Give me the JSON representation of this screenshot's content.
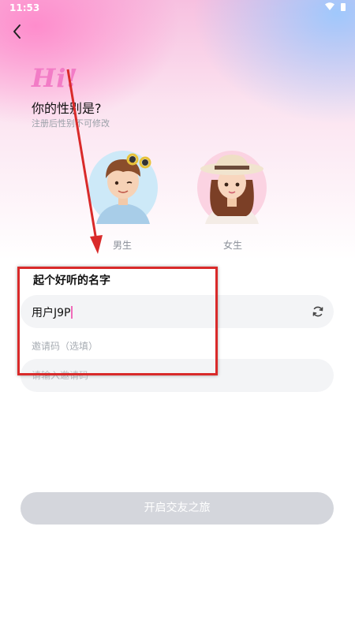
{
  "status_bar": {
    "time": "11:53"
  },
  "header": {
    "back_icon": "chevron-left-icon"
  },
  "hero": {
    "greeting": "Hi!",
    "question": "你的性别是?",
    "note": "注册后性别不可修改"
  },
  "gender": {
    "male_label": "男生",
    "female_label": "女生"
  },
  "name_section": {
    "title": "起个好听的名字",
    "value": "用户J9P",
    "refresh_icon": "refresh-icon"
  },
  "invite_section": {
    "label": "邀请码（选填）",
    "placeholder": "请输入邀请码"
  },
  "submit": {
    "label": "开启交友之旅"
  },
  "colors": {
    "accent_pink": "#f27cc6",
    "annotation_red": "#d92a2a",
    "button_disabled": "#d4d6dc"
  }
}
